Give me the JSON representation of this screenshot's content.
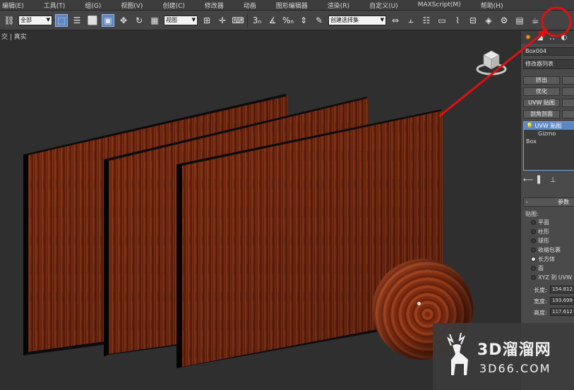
{
  "menu": [
    "编辑(E)",
    "工具(T)",
    "组(G)",
    "视图(V)",
    "创建(C)",
    "修改器",
    "动画",
    "图形编辑器",
    "渲染(R)",
    "自定义(U)",
    "MAXScript(M)",
    "帮助(H)"
  ],
  "toolbar": {
    "selection_filter": "全部",
    "reference_coord": "视图",
    "named_selection": "创建选择集"
  },
  "viewport": {
    "label": "交 | 真实"
  },
  "command_panel": {
    "object_name": "Box004",
    "modifier_list": "修改器列表",
    "buttons": [
      "挤出",
      "优化",
      "UVW 贴图",
      "剖角剖面"
    ],
    "stack": {
      "modifier": "UVW 贴图",
      "sub": "Gizmo",
      "base": "Box"
    },
    "params_title": "参数",
    "mapping_group": "贴图:",
    "mapping_options": [
      "平面",
      "柱形",
      "球形",
      "收缩包裹",
      "长方体",
      "面",
      "XYZ 到 UVW"
    ],
    "selected_mapping": "长方体",
    "dims": [
      {
        "label": "长度:",
        "value": "154.812"
      },
      {
        "label": "宽度:",
        "value": "193.699"
      },
      {
        "label": "高度:",
        "value": "117.612"
      }
    ]
  },
  "watermark": {
    "brand": "3D溜溜网",
    "url": "3D66.COM"
  },
  "colors": {
    "highlight_circle": "#e01010",
    "arrow": "#e01010",
    "active_tool": "#5d87c4"
  }
}
